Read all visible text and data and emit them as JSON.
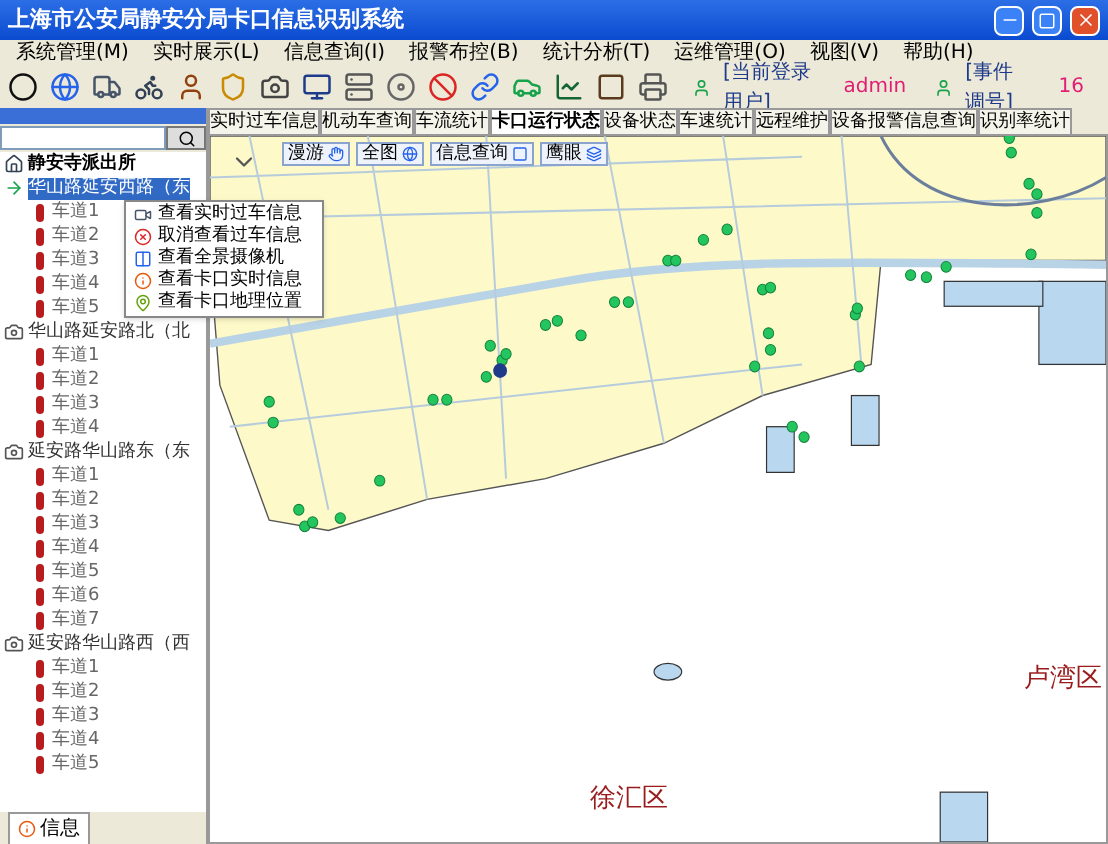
{
  "window": {
    "title": "上海市公安局静安分局卡口信息识别系统"
  },
  "menu": [
    "系统管理(M)",
    "实时展示(L)",
    "信息查询(I)",
    "报警布控(B)",
    "统计分析(T)",
    "运维管理(O)",
    "视图(V)",
    "帮助(H)"
  ],
  "toolbar": {
    "user_label": "[当前登录用户]",
    "user": "admin",
    "event_label": "[事件调号]",
    "event_count": "16"
  },
  "tree": {
    "root": "静安寺派出所",
    "groups": [
      {
        "name": "华山路延安西路（东",
        "selected": true,
        "lanes": [
          "车道1",
          "车道2",
          "车道3",
          "车道4",
          "车道5"
        ]
      },
      {
        "name": "华山路延安路北（北",
        "selected": false,
        "lanes": [
          "车道1",
          "车道2",
          "车道3",
          "车道4"
        ]
      },
      {
        "name": "延安路华山路东（东",
        "selected": false,
        "lanes": [
          "车道1",
          "车道2",
          "车道3",
          "车道4",
          "车道5",
          "车道6",
          "车道7"
        ]
      },
      {
        "name": "延安路华山路西（西",
        "selected": false,
        "lanes": [
          "车道1",
          "车道2",
          "车道3",
          "车道4",
          "车道5"
        ]
      }
    ]
  },
  "bottom_tab": "信息",
  "context_menu": [
    "查看实时过车信息",
    "取消查看过车信息",
    "查看全景摄像机",
    "查看卡口实时信息",
    "查看卡口地理位置"
  ],
  "tabs": [
    {
      "label": "实时过车信息",
      "selected": false
    },
    {
      "label": "机动车查询",
      "selected": false
    },
    {
      "label": "车流统计",
      "selected": false
    },
    {
      "label": "卡口运行状态",
      "selected": true
    },
    {
      "label": "设备状态",
      "selected": false
    },
    {
      "label": "车速统计",
      "selected": false
    },
    {
      "label": "远程维护",
      "selected": false
    },
    {
      "label": "设备报警信息查询",
      "selected": false
    },
    {
      "label": "识别率统计",
      "selected": false
    }
  ],
  "map_tools": [
    "漫游",
    "全图",
    "信息查询",
    "鹰眼"
  ],
  "map": {
    "districts": [
      "徐汇区",
      "卢湾区"
    ]
  }
}
